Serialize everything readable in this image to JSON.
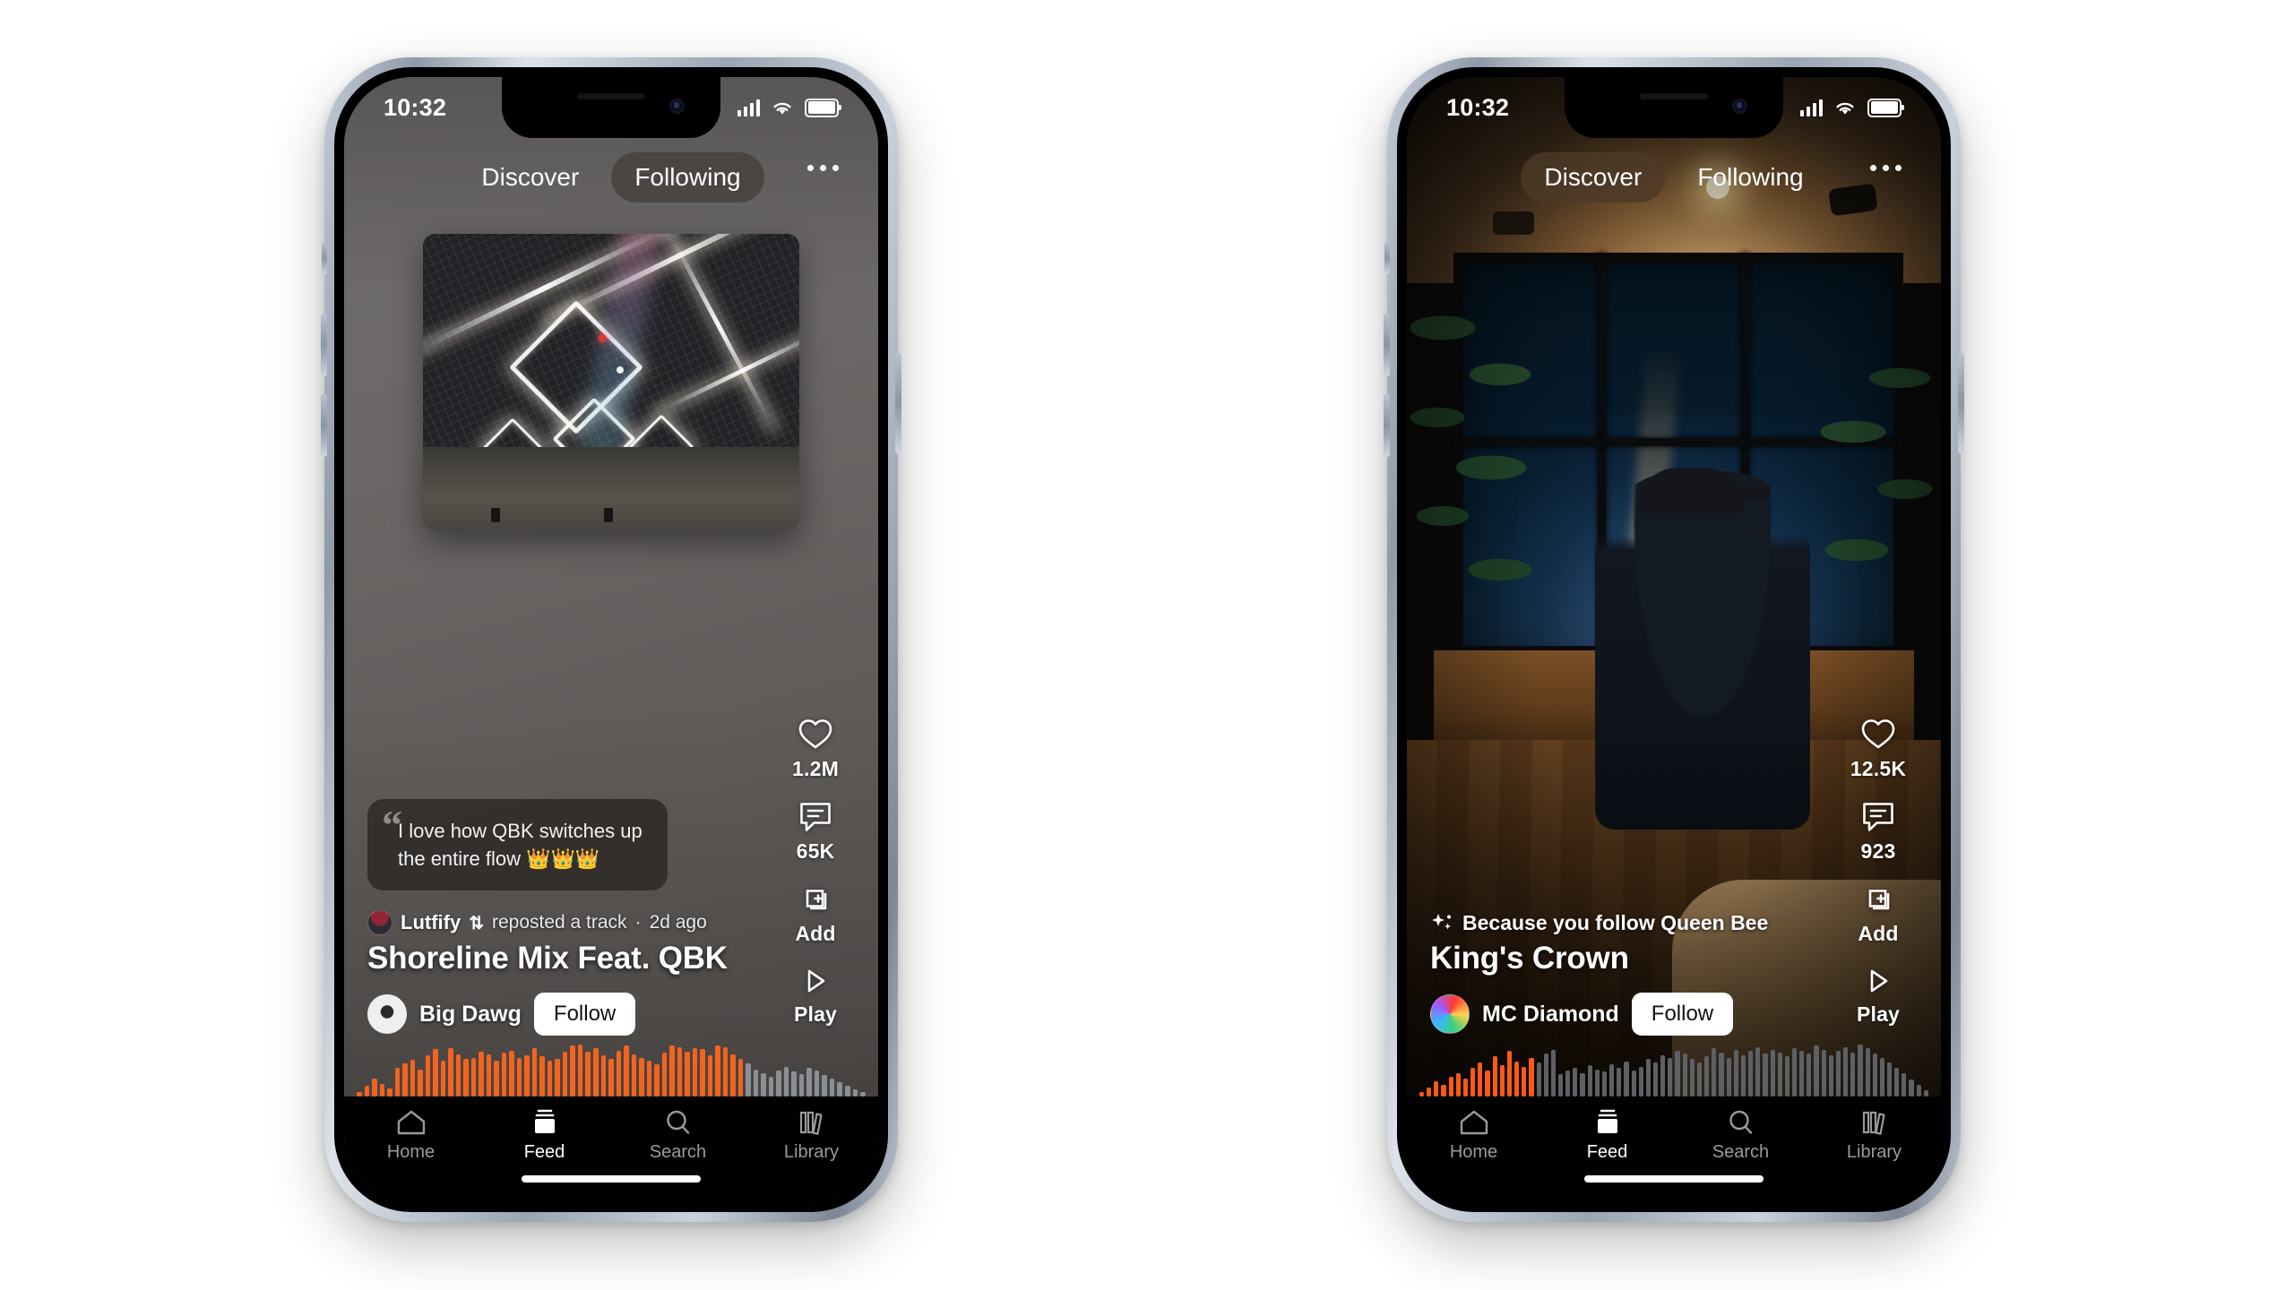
{
  "app": {
    "accent_orange": "#f4631e",
    "waveform_inactive": "#8a8f94"
  },
  "status_bar": {
    "time": "10:32",
    "signal_icon": "cellular-signal-icon",
    "wifi_icon": "wifi-icon",
    "battery_icon": "battery-icon"
  },
  "tabs": {
    "discover": "Discover",
    "following": "Following",
    "overflow_icon": "more-options-icon"
  },
  "rail": {
    "like_icon": "heart-icon",
    "comment_icon": "comment-icon",
    "add_icon": "add-to-playlist-icon",
    "play_icon": "play-icon",
    "add_label": "Add",
    "play_label": "Play"
  },
  "tabbar": {
    "items": [
      {
        "label": "Home",
        "icon": "home-icon",
        "active": false
      },
      {
        "label": "Feed",
        "icon": "feed-icon",
        "active": true
      },
      {
        "label": "Search",
        "icon": "search-icon",
        "active": false
      },
      {
        "label": "Library",
        "icon": "library-icon",
        "active": false
      }
    ]
  },
  "left_phone": {
    "active_tab": "Following",
    "quote": {
      "mark": "“",
      "text": "I love how QBK switches up the entire flow 👑👑👑"
    },
    "meta": {
      "avatar": "lutfify-avatar",
      "user": "Lutfify",
      "repost_icon": "⇅",
      "action": "reposted a track",
      "separator": "·",
      "time": "2d ago"
    },
    "track_title": "Shoreline Mix Feat. QBK",
    "artist": {
      "avatar": "big-dawg-avatar",
      "name": "Big Dawg",
      "follow_label": "Follow"
    },
    "stats": {
      "likes": "1.2M",
      "comments": "65K"
    },
    "waveform": {
      "progress_percent": 76,
      "bars": [
        6,
        18,
        30,
        22,
        14,
        48,
        56,
        62,
        46,
        70,
        80,
        60,
        82,
        72,
        64,
        66,
        76,
        72,
        60,
        74,
        78,
        66,
        70,
        82,
        68,
        60,
        64,
        76,
        86,
        88,
        76,
        82,
        70,
        64,
        78,
        86,
        72,
        66,
        60,
        54,
        74,
        86,
        84,
        76,
        82,
        80,
        70,
        86,
        84,
        72,
        64,
        56,
        46,
        40,
        34,
        44,
        50,
        42,
        38,
        48,
        44,
        36,
        30,
        24,
        18,
        12,
        8
      ]
    }
  },
  "right_phone": {
    "active_tab": "Discover",
    "reason": {
      "icon": "sparkle-icon",
      "text": "Because you follow Queen Bee"
    },
    "track_title": "King's Crown",
    "artist": {
      "avatar": "mc-diamond-avatar",
      "name": "MC Diamond",
      "follow_label": "Follow"
    },
    "stats": {
      "likes": "12.5K",
      "comments": "923"
    },
    "waveform": {
      "progress_percent": 23,
      "bars": [
        6,
        14,
        24,
        18,
        30,
        36,
        28,
        44,
        52,
        40,
        62,
        48,
        70,
        54,
        46,
        60,
        52,
        66,
        72,
        34,
        40,
        44,
        36,
        48,
        42,
        38,
        50,
        44,
        54,
        40,
        46,
        58,
        52,
        64,
        60,
        70,
        66,
        58,
        52,
        62,
        74,
        68,
        60,
        72,
        64,
        70,
        76,
        66,
        72,
        68,
        62,
        74,
        70,
        66,
        78,
        72,
        64,
        70,
        76,
        68,
        80,
        74,
        66,
        60,
        52,
        44,
        36,
        26,
        18,
        10
      ]
    }
  }
}
